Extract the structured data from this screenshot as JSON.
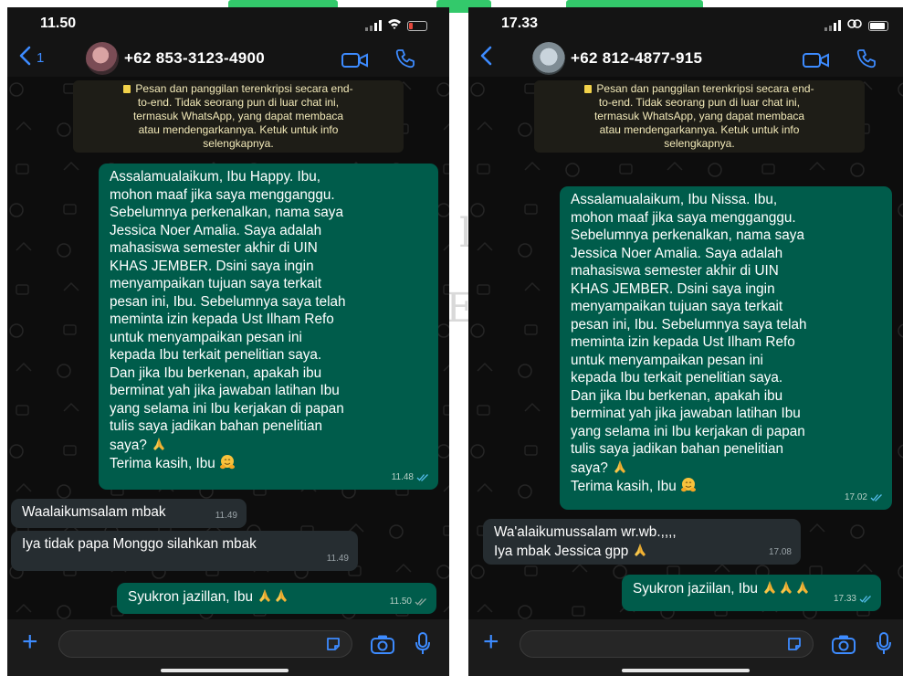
{
  "background": {
    "watermark": [
      "l",
      "E"
    ]
  },
  "screens": [
    {
      "status": {
        "time": "11.50",
        "battery": "low"
      },
      "header": {
        "back_count": "1",
        "contact": "+62 853-3123-4900"
      },
      "notice": [
        "Pesan dan panggilan terenkripsi secara end-",
        "to-end. Tidak seorang pun di luar chat ini,",
        "termasuk WhatsApp, yang dapat membaca",
        "atau mendengarkannya. Ketuk untuk info",
        "selengkapnya."
      ],
      "messages": [
        {
          "direction": "out",
          "lines": [
            "Assalamualaikum, Ibu Happy. Ibu,",
            "mohon maaf jika saya mengganggu.",
            "Sebelumnya perkenalkan, nama saya",
            "Jessica Noer Amalia. Saya adalah",
            "mahasiswa semester akhir di UIN",
            "KHAS JEMBER. Dsini saya ingin",
            "menyampaikan tujuan saya terkait",
            "pesan ini, Ibu. Sebelumnya saya telah",
            "meminta izin kepada Ust Ilham Refo",
            "untuk menyampaikan pesan ini",
            "kepada Ibu terkait penelitian saya.",
            "Dan jika Ibu berkenan, apakah ibu",
            "berminat yah jika jawaban latihan Ibu",
            "yang selama ini Ibu kerjakan di papan",
            "tulis saya jadikan bahan penelitian",
            "saya? 🙏",
            "Terima kasih, Ibu 🤗"
          ],
          "time": "11.48",
          "status": "read"
        },
        {
          "direction": "in",
          "lines": [
            "Waalaikumsalam mbak"
          ],
          "time": "11.49"
        },
        {
          "direction": "in",
          "lines": [
            "Iya tidak papa Monggo silahkan mbak"
          ],
          "time": "11.49"
        },
        {
          "direction": "out",
          "lines": [
            "Syukron jazillan, Ibu 🙏🙏"
          ],
          "time": "11.50",
          "status": "sent"
        }
      ]
    },
    {
      "status": {
        "time": "17.33",
        "battery": "full"
      },
      "header": {
        "back_count": "",
        "contact": "+62 812-4877-915"
      },
      "notice": [
        "Pesan dan panggilan terenkripsi secara end-",
        "to-end. Tidak seorang pun di luar chat ini,",
        "termasuk WhatsApp, yang dapat membaca",
        "atau mendengarkannya. Ketuk untuk info",
        "selengkapnya."
      ],
      "messages": [
        {
          "direction": "out",
          "lines": [
            "Assalamualaikum, Ibu Nissa. Ibu,",
            "mohon maaf jika saya mengganggu.",
            "Sebelumnya perkenalkan, nama saya",
            "Jessica Noer Amalia. Saya adalah",
            "mahasiswa semester akhir di UIN",
            "KHAS JEMBER. Dsini saya ingin",
            "menyampaikan tujuan saya terkait",
            "pesan ini, Ibu. Sebelumnya saya telah",
            "meminta izin kepada Ust Ilham Refo",
            "untuk menyampaikan pesan ini",
            "kepada Ibu terkait penelitian saya.",
            "Dan jika Ibu berkenan, apakah ibu",
            "berminat yah jika jawaban latihan Ibu",
            "yang selama ini Ibu kerjakan di papan",
            "tulis saya jadikan bahan penelitian",
            "saya? 🙏",
            "Terima kasih, Ibu 🤗"
          ],
          "time": "17.02",
          "status": "read"
        },
        {
          "direction": "in",
          "lines": [
            "Wa'alaikumussalam wr.wb.,,,,",
            "Iya mbak Jessica gpp 🙏"
          ],
          "time": "17.08"
        },
        {
          "direction": "out",
          "lines": [
            "Syukron jaziilan, Ibu 🙏🙏🙏"
          ],
          "time": "17.33",
          "status": "read"
        }
      ]
    }
  ],
  "colors": {
    "accent": "#3d8bff",
    "bubble_out": "#005c4b",
    "bubble_in": "#262d31",
    "read_ticks": "#53bdeb",
    "sent_ticks": "#8fa9a0",
    "battery_low": "#e5473b"
  },
  "icons": {
    "back": "chevron-left-icon",
    "video": "video-camera-icon",
    "call": "phone-icon",
    "lock": "lock-icon",
    "plus": "plus-icon",
    "sticker": "sticker-icon",
    "camera": "camera-icon",
    "mic": "microphone-icon",
    "pray": "folded-hands-emoji",
    "hug": "hugging-face-emoji"
  }
}
